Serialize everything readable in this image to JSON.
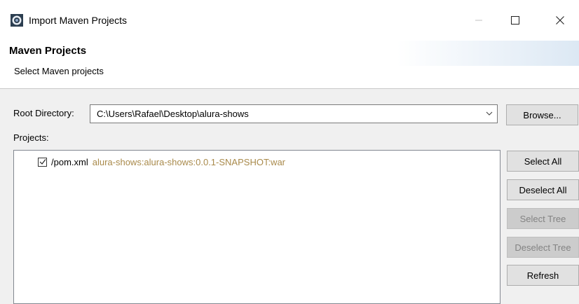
{
  "window": {
    "title": "Import Maven Projects",
    "minimize_icon": "minimize-icon",
    "maximize_icon": "maximize-icon",
    "close_icon": "close-icon"
  },
  "header": {
    "title": "Maven Projects",
    "description": "Select Maven projects"
  },
  "root_directory": {
    "label": "Root Directory:",
    "value": "C:\\Users\\Rafael\\Desktop\\alura-shows",
    "browse_label": "Browse..."
  },
  "projects": {
    "label": "Projects:",
    "items": [
      {
        "checked": true,
        "name": "/pom.xml",
        "artifact": "alura-shows:alura-shows:0.0.1-SNAPSHOT:war"
      }
    ]
  },
  "buttons": {
    "select_all": "Select All",
    "deselect_all": "Deselect All",
    "select_tree": "Select Tree",
    "deselect_tree": "Deselect Tree",
    "refresh": "Refresh"
  },
  "colors": {
    "artifact_text": "#a98a4b",
    "disabled_text": "#838383"
  }
}
